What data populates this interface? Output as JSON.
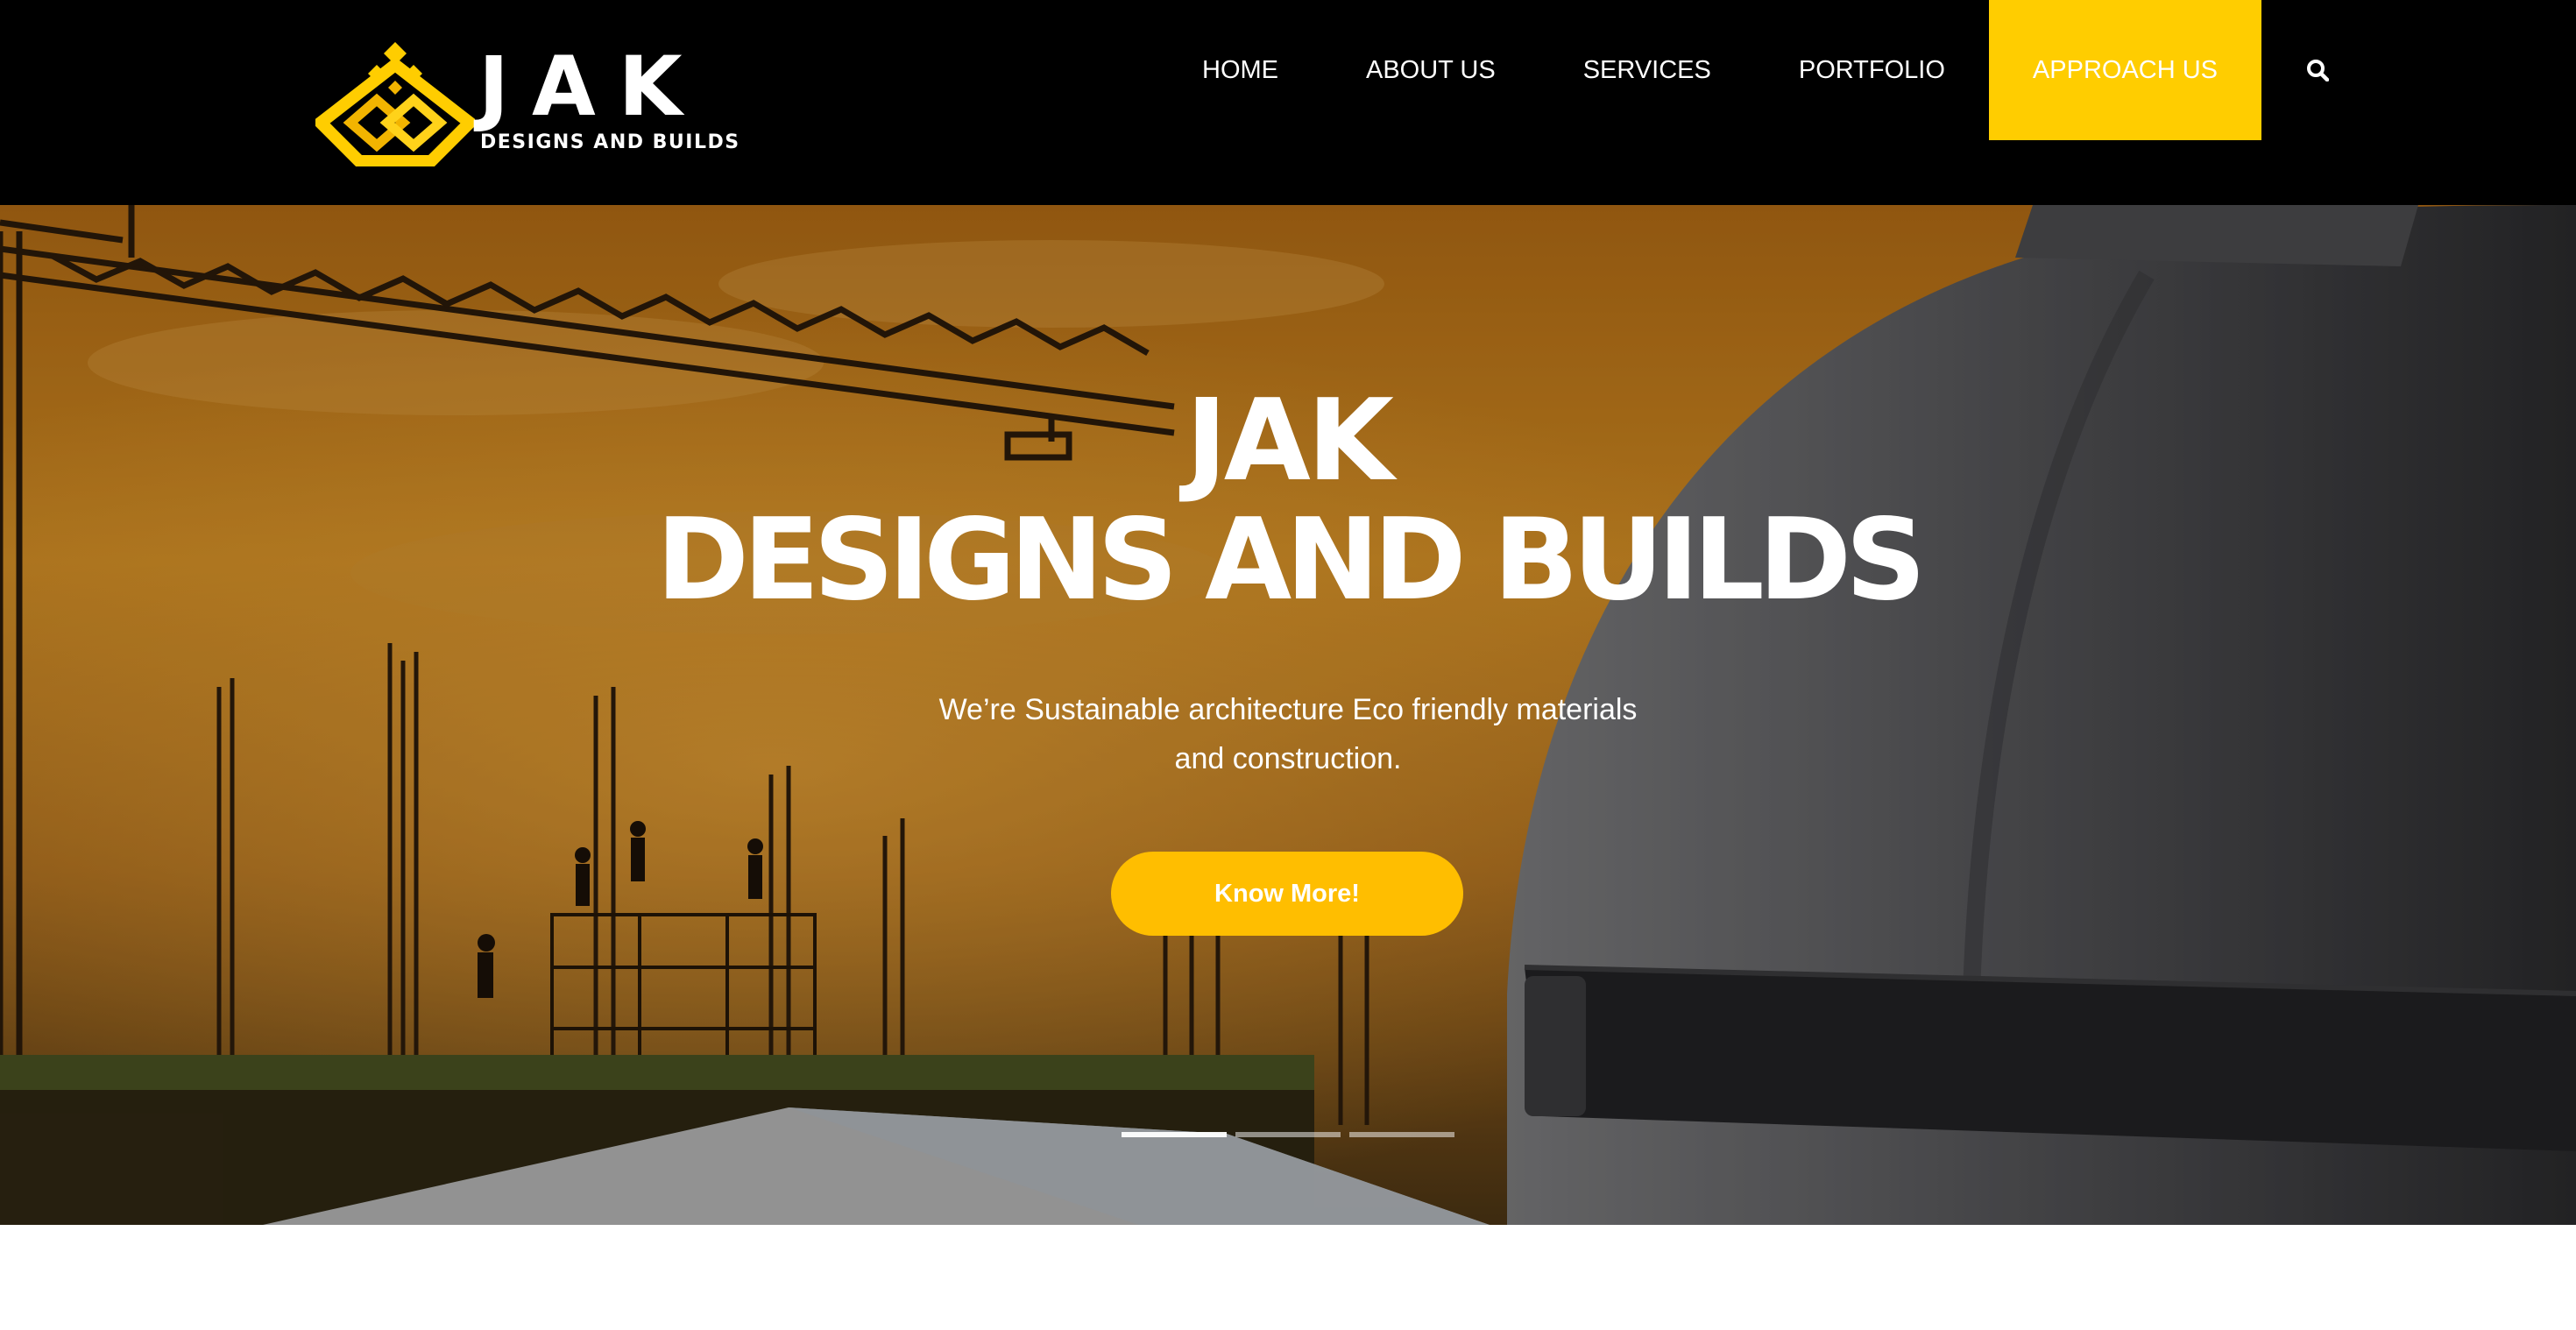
{
  "brand": {
    "name": "JAK",
    "tagline": "DESIGNS AND BUILDS",
    "accent_color": "#ffcd00",
    "button_color": "#ffbe00"
  },
  "nav": {
    "items": [
      {
        "label": "HOME",
        "active": false
      },
      {
        "label": "ABOUT US",
        "active": false
      },
      {
        "label": "SERVICES",
        "active": false
      },
      {
        "label": "PORTFOLIO",
        "active": false
      },
      {
        "label": "APPROACH US",
        "active": true
      }
    ],
    "search_icon": "search-icon"
  },
  "hero": {
    "title_line1": "JAK",
    "title_line2": "DESIGNS AND BUILDS",
    "subtitle": "We’re Sustainable architecture Eco friendly materials and construction.",
    "button_label": "Know More!",
    "slides": 3,
    "active_slide": 1
  }
}
